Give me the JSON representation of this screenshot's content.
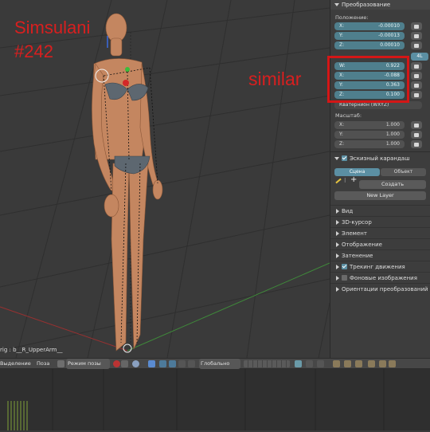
{
  "overlay": {
    "title_line1": "Simsulani",
    "title_line2": "#242",
    "annotation": "similar",
    "annotation_color": "#d41616"
  },
  "viewport": {
    "bone_label": "rig : b__R_UpperArm__"
  },
  "panel": {
    "transform_header": "Преобразование",
    "location_label": "Положение:",
    "location": [
      {
        "axis": "X:",
        "value": "-0.00010"
      },
      {
        "axis": "Y:",
        "value": "-0.00013"
      },
      {
        "axis": "Z:",
        "value": "0.00010"
      }
    ],
    "quat_mode_badge": "4L",
    "rotation": [
      {
        "axis": "W:",
        "value": "0.922"
      },
      {
        "axis": "X:",
        "value": "-0.088"
      },
      {
        "axis": "Y:",
        "value": "0.363"
      },
      {
        "axis": "Z:",
        "value": "0.100"
      }
    ],
    "rotation_mode_label": "Кватернион (WXYZ)",
    "scale_label": "Масштаб:",
    "scale": [
      {
        "axis": "X:",
        "value": "1.000"
      },
      {
        "axis": "Y:",
        "value": "1.000"
      },
      {
        "axis": "Z:",
        "value": "1.000"
      }
    ],
    "grease_pencil_header": "Эскизный карандаш",
    "tab_scene": "Сцена",
    "tab_object": "Объект",
    "create_button": "Создать",
    "new_layer_button": "New Layer",
    "collapsed_sections": [
      {
        "label": "Вид",
        "checkbox": "none"
      },
      {
        "label": "3D-курсор",
        "checkbox": "none"
      },
      {
        "label": "Элемент",
        "checkbox": "none"
      },
      {
        "label": "Отображение",
        "checkbox": "none"
      },
      {
        "label": "Затенение",
        "checkbox": "none"
      },
      {
        "label": "Трекинг движения",
        "checkbox": "on"
      },
      {
        "label": "Фоновые изображения",
        "checkbox": "off"
      },
      {
        "label": "Ориентации преобразований",
        "checkbox": "none"
      }
    ]
  },
  "header": {
    "select_menu": "Выделение",
    "pose_menu": "Поза",
    "mode_dropdown": "Режим позы",
    "orientation_dropdown": "Глобально"
  },
  "colors": {
    "field_blue": "#4f7f8d",
    "active_tab": "#5b8fa3",
    "timeline_marks": "#7fa13a"
  }
}
